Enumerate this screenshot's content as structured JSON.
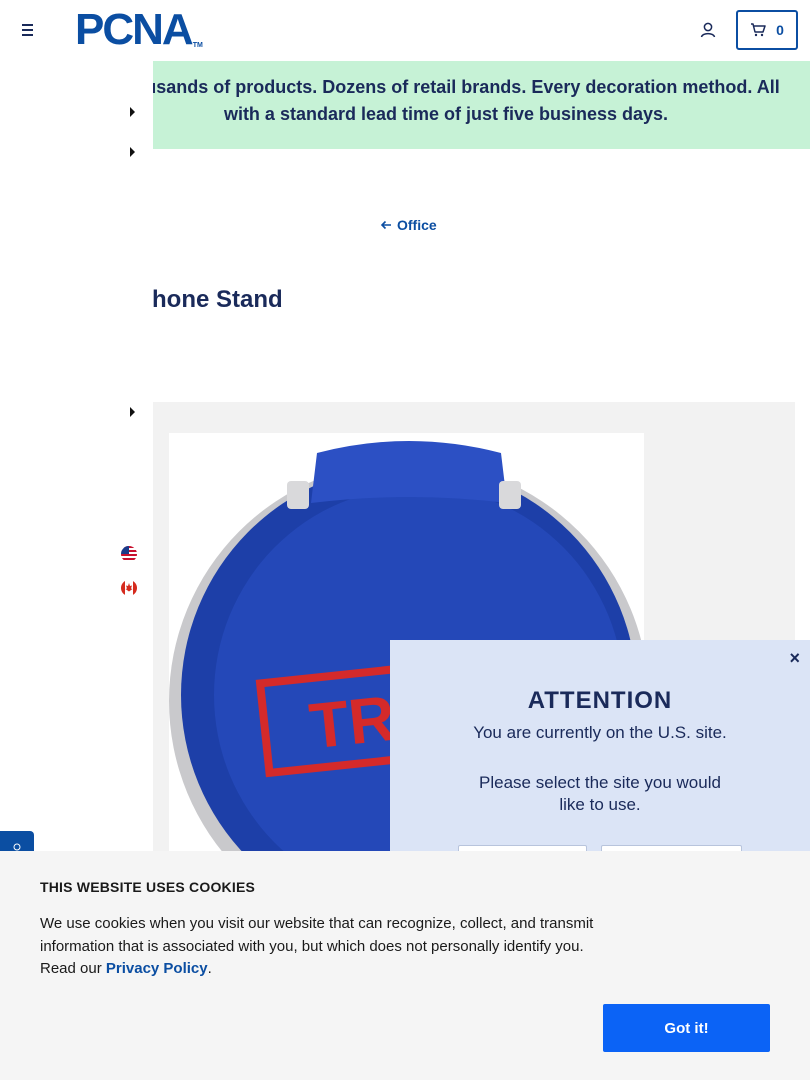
{
  "header": {
    "logo_text": "PCNA",
    "logo_tm": "TM",
    "cart_count": "0"
  },
  "banner": {
    "text": "Thousands of products. Dozens of retail brands. Every decoration method. All with a standard lead time of just five business days."
  },
  "breadcrumb": {
    "label": "Office"
  },
  "product": {
    "title_visible": "nd Phone Stand",
    "imprint_text": "TRY"
  },
  "attention_modal": {
    "close_symbol": "×",
    "title": "ATTENTION",
    "line1": "You are currently on the U.S. site.",
    "line2": "Please select the site you would like to use."
  },
  "cookie_banner": {
    "title": "THIS WEBSITE USES COOKIES",
    "body_prefix": "We use cookies when you visit our website that can recognize, collect, and transmit information that is associated with you, but which does not personally identify you. Read our ",
    "privacy_link": "Privacy Policy",
    "body_suffix": ".",
    "button_label": "Got it!"
  },
  "colors": {
    "brand_blue": "#0b4ea2",
    "banner_green": "#c6f2d6",
    "modal_bg": "#dbe4f6",
    "cookie_button": "#0b63f6"
  },
  "icons": {
    "menu": "hamburger-icon",
    "account": "user-icon",
    "cart": "cart-icon",
    "back": "arrow-left-icon",
    "flag_us": "us-flag-icon",
    "flag_ca": "canada-flag-icon"
  }
}
